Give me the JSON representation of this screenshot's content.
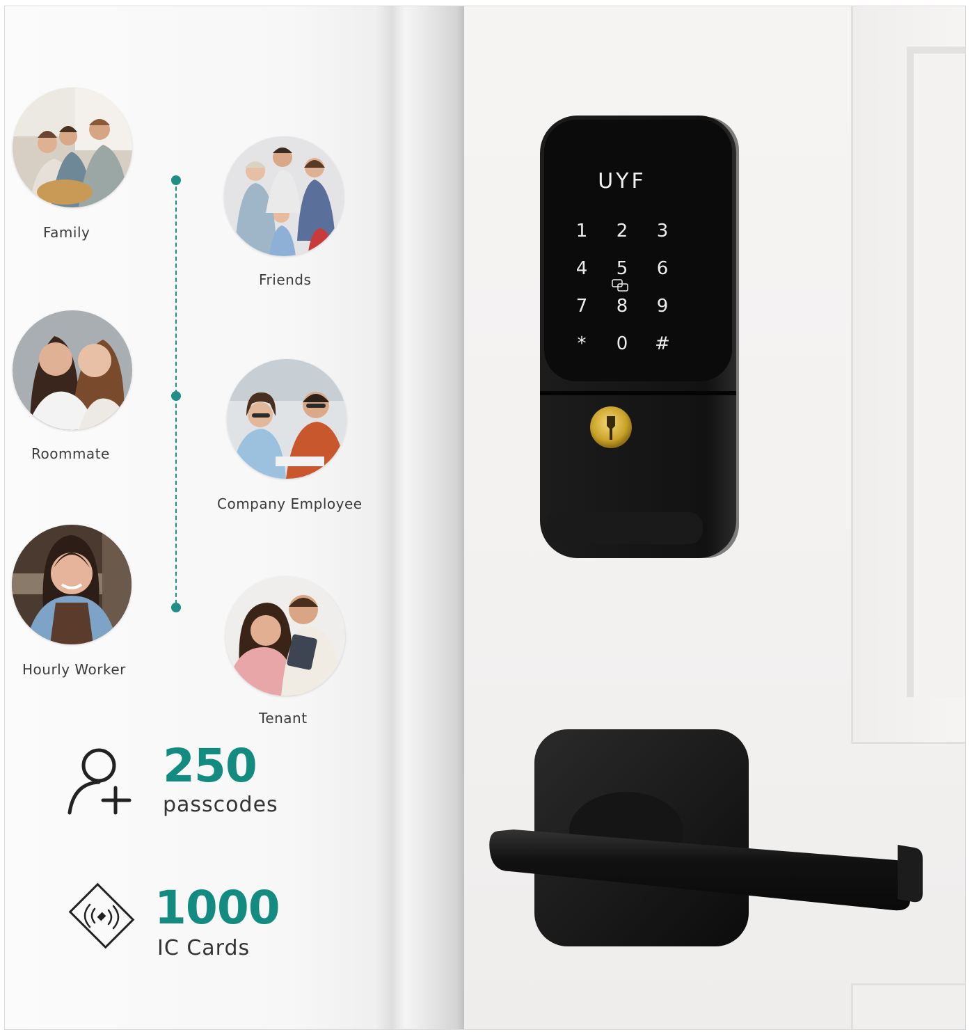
{
  "people": [
    {
      "label": "Family"
    },
    {
      "label": "Friends"
    },
    {
      "label": "Roommate"
    },
    {
      "label": "Company Employee"
    },
    {
      "label": "Hourly Worker"
    },
    {
      "label": "Tenant"
    }
  ],
  "stats": {
    "passcodes": {
      "value": "250",
      "label": "passcodes",
      "icon": "add-user-icon"
    },
    "cards": {
      "value": "1000",
      "label": "IC Cards",
      "icon": "rfid-card-icon"
    }
  },
  "lock": {
    "brand": "UYF",
    "keys": [
      "1",
      "2",
      "3",
      "4",
      "5",
      "6",
      "7",
      "8",
      "9",
      "*",
      "0",
      "#"
    ]
  },
  "colors": {
    "accent": "#138b80",
    "lock_body": "#141414",
    "keyhole": "#c9a227"
  }
}
